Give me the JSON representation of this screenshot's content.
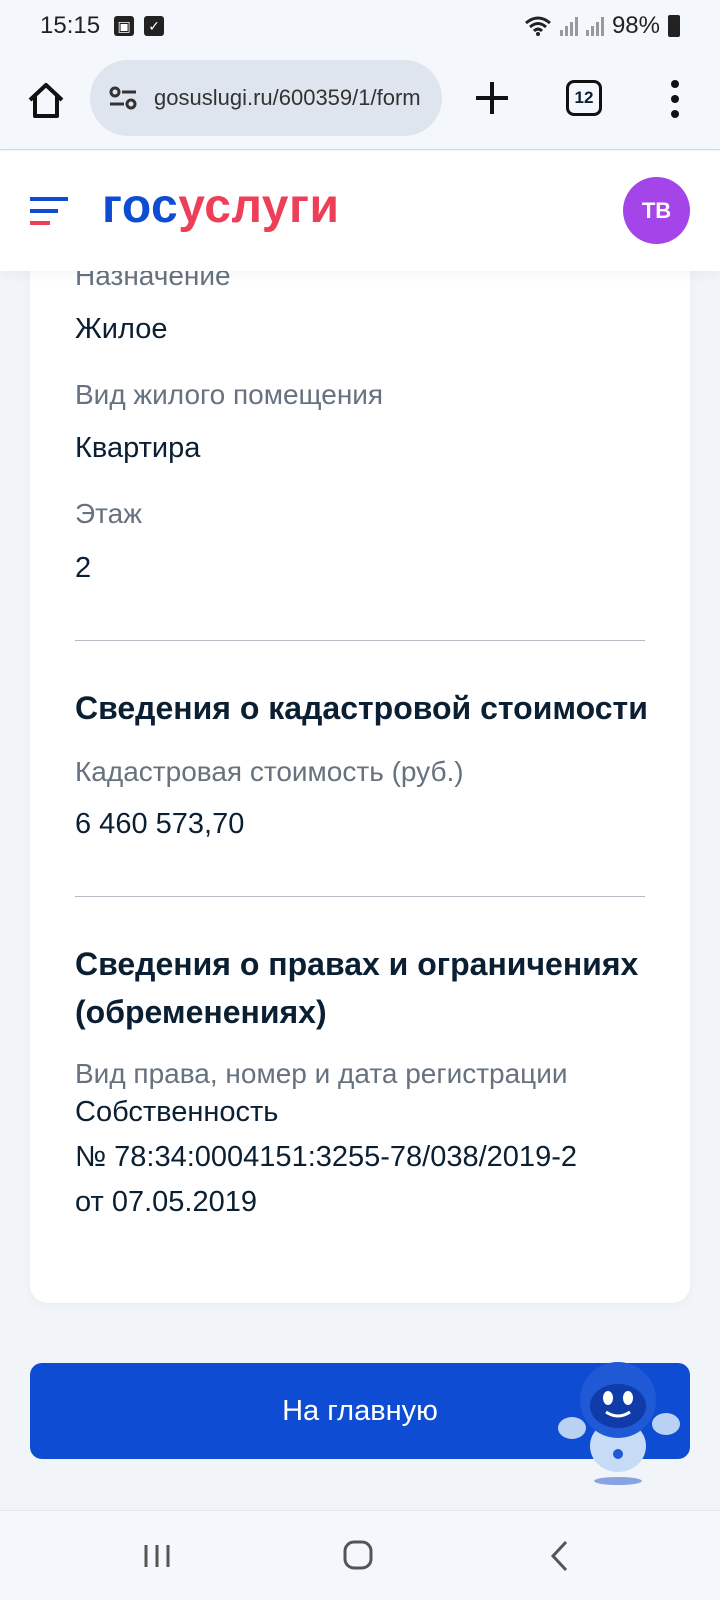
{
  "status_bar": {
    "time": "15:15",
    "battery": "98%"
  },
  "browser": {
    "url": "gosuslugi.ru/600359/1/form",
    "tab_count": "12"
  },
  "header": {
    "logo_part1": "гос",
    "logo_part2": "услуги",
    "avatar_initials": "ТВ"
  },
  "details": {
    "purpose_label": "Назначение",
    "purpose_value": "Жилое",
    "premises_type_label": "Вид жилого помещения",
    "premises_type_value": "Квартира",
    "floor_label": "Этаж",
    "floor_value": "2"
  },
  "cadastral": {
    "title": "Сведения о кадастровой стоимости",
    "value_label": "Кадастровая стоимость (руб.)",
    "value": "6 460 573,70"
  },
  "rights": {
    "title_line1": "Сведения о правах и ограничениях",
    "title_line2": "(обременениях)",
    "label": "Вид права, номер и дата регистрации",
    "line1": "Собственность",
    "line2": "№ 78:34:0004151:3255-78/038/2019-2",
    "line3": "от 07.05.2019"
  },
  "actions": {
    "home_button": "На главную"
  },
  "colors": {
    "brand_blue": "#0d4cd3",
    "brand_red": "#ee3f58",
    "avatar": "#a445ea"
  }
}
